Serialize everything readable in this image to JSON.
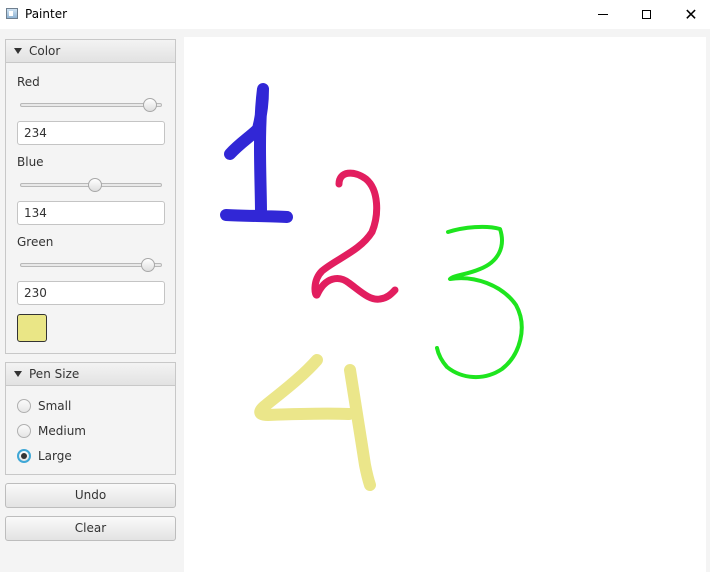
{
  "window": {
    "title": "Painter"
  },
  "color_pane": {
    "title": "Color",
    "red": {
      "label": "Red",
      "value": "234",
      "slider_fraction": 0.917
    },
    "blue": {
      "label": "Blue",
      "value": "134",
      "slider_fraction": 0.525
    },
    "green": {
      "label": "Green",
      "value": "230",
      "slider_fraction": 0.902
    },
    "swatch_color": "#eae686"
  },
  "pen_size_pane": {
    "title": "Pen Size",
    "options": [
      {
        "label": "Small",
        "selected": false
      },
      {
        "label": "Medium",
        "selected": false
      },
      {
        "label": "Large",
        "selected": true
      }
    ]
  },
  "buttons": {
    "undo": "Undo",
    "clear": "Clear"
  },
  "strokes": {
    "one_color": "#3127d6",
    "two_color": "#e21e5f",
    "three_color": "#1ee51e",
    "four_color": "#ebe68a"
  }
}
